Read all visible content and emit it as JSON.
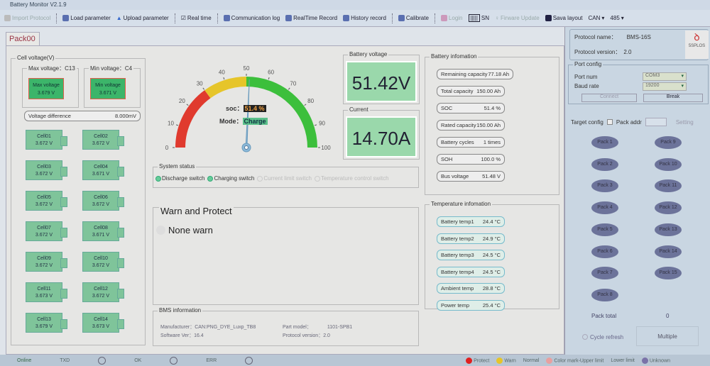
{
  "window": {
    "title": "Battery Monitor V2.1.9"
  },
  "toolbar": {
    "import": "Import Protocol",
    "load": "Load parameter",
    "upload": "Upload parameter",
    "realtime": "Real time",
    "comm": "Communication log",
    "rtrecord": "RealTime Record",
    "history": "History record",
    "calibrate": "Calibrate",
    "login": "Login",
    "sn": "SN",
    "firmware": "Firware Update",
    "save": "Sava layout",
    "can": "CAN",
    "485": "485"
  },
  "tab": "Pack00",
  "cell_voltage": {
    "title": "Cell voltage(V)",
    "max_title": "Max voltage：C13",
    "min_title": "Min voltage：C4",
    "max_label": "Max voltage",
    "max_value": "3.679 V",
    "min_label": "Min voltage",
    "min_value": "3.671 V",
    "diff_label": "Voltage difference",
    "diff_value": "8.000mV",
    "cells": [
      {
        "name": "Cell01",
        "v": "3.672 V"
      },
      {
        "name": "Cell02",
        "v": "3.672 V"
      },
      {
        "name": "Cell03",
        "v": "3.672 V"
      },
      {
        "name": "Cell04",
        "v": "3.671 V"
      },
      {
        "name": "Cell05",
        "v": "3.672 V"
      },
      {
        "name": "Cell06",
        "v": "3.672 V"
      },
      {
        "name": "Cell07",
        "v": "3.672 V"
      },
      {
        "name": "Cell08",
        "v": "3.671 V"
      },
      {
        "name": "Cell09",
        "v": "3.672 V"
      },
      {
        "name": "Cell10",
        "v": "3.672 V"
      },
      {
        "name": "Cell11",
        "v": "3.673 V"
      },
      {
        "name": "Cell12",
        "v": "3.672 V"
      },
      {
        "name": "Cell13",
        "v": "3.679 V"
      },
      {
        "name": "Cell14",
        "v": "3.673 V"
      }
    ]
  },
  "gauge": {
    "soc_value": 51.4,
    "ticks": [
      "0",
      "10",
      "20",
      "30",
      "40",
      "50",
      "60",
      "70",
      "80",
      "90",
      "100"
    ],
    "soc_label": "soc：",
    "soc_text": "51.4 %",
    "mode_label": "Mode：",
    "mode_text": "Charge",
    "colors": {
      "red": "#e03a2e",
      "yellow": "#e6c52a",
      "green": "#3cbf3c"
    }
  },
  "voltage": {
    "title": "Battery voltage",
    "value": "51.42V"
  },
  "current": {
    "title": "Current",
    "value": "14.70A"
  },
  "battery_info": {
    "title": "Battery infomation",
    "items": [
      {
        "l": "Remaining capacity",
        "v": "77.18 Ah"
      },
      {
        "l": "Total capacity",
        "v": "150.00 Ah"
      },
      {
        "l": "SOC",
        "v": "51.4 %"
      },
      {
        "l": "Rated capacity",
        "v": "150.00 Ah"
      },
      {
        "l": "Battery cycles",
        "v": "1 times"
      },
      {
        "l": "SOH",
        "v": "100.0 %"
      },
      {
        "l": "Bus voltage",
        "v": "51.48 V"
      }
    ]
  },
  "system_status": {
    "title": "System status",
    "switches": [
      {
        "l": "Discharge switch",
        "on": true
      },
      {
        "l": "Charging switch",
        "on": true
      },
      {
        "l": "Current limit switch",
        "on": false
      },
      {
        "l": "Temperature control switch",
        "on": false
      }
    ]
  },
  "warn": {
    "title": "Warn and Protect",
    "status": "None warn"
  },
  "bms": {
    "title": "BMS information",
    "manufacturer_label": "Manufacturer：",
    "manufacturer": "CAN:PNG_DYE_Luxp_TB8",
    "software_label": "Software Ver：",
    "software": "16.4",
    "part_label": "Part model：",
    "part": "1101-SPB1",
    "proto_label": "Protocol version：",
    "proto": "2.0"
  },
  "temperature": {
    "title": "Temperature infomation",
    "items": [
      {
        "l": "Battery temp1",
        "v": "24.4 °C"
      },
      {
        "l": "Battery temp2",
        "v": "24.9 °C"
      },
      {
        "l": "Battery temp3",
        "v": "24.5 °C"
      },
      {
        "l": "Battery temp4",
        "v": "24.5 °C"
      },
      {
        "l": "Ambient temp",
        "v": "28.8 °C"
      },
      {
        "l": "Power temp",
        "v": "25.4 °C"
      }
    ]
  },
  "right": {
    "proto_name_label": "Protocol name：",
    "proto_name": "BMS-16S",
    "proto_ver_label": "Protocol version：",
    "proto_ver": "2.0",
    "port_title": "Port config",
    "port_label": "Port num",
    "port": "COM3",
    "baud_label": "Baud rate",
    "baud": "19200",
    "connect": "Connect",
    "break": "Break",
    "target_title": "Target config",
    "pack_addr": "Pack addr",
    "setting": "Setting",
    "packs": [
      "Pack 1",
      "Pack 2",
      "Pack 3",
      "Pack 4",
      "Pack 5",
      "Pack 6",
      "Pack 7",
      "Pack 8",
      "Pack 9",
      "Pack 10",
      "Pack 11",
      "Pack 12",
      "Pack 13",
      "Pack 14",
      "Pack 15"
    ],
    "pack_total_label": "Pack total",
    "pack_total": "0",
    "cycle_refresh": "Cycle refresh",
    "multiple": "Multiple"
  },
  "statusbar": {
    "online": "Online",
    "txd": "TXD",
    "ok": "OK",
    "err": "ERR",
    "protect": "Protect",
    "warn": "Warn",
    "normal": "Normal",
    "upper": "Color mark-Upper limit",
    "lower": "Lower limit",
    "unknown": "Unknown"
  }
}
